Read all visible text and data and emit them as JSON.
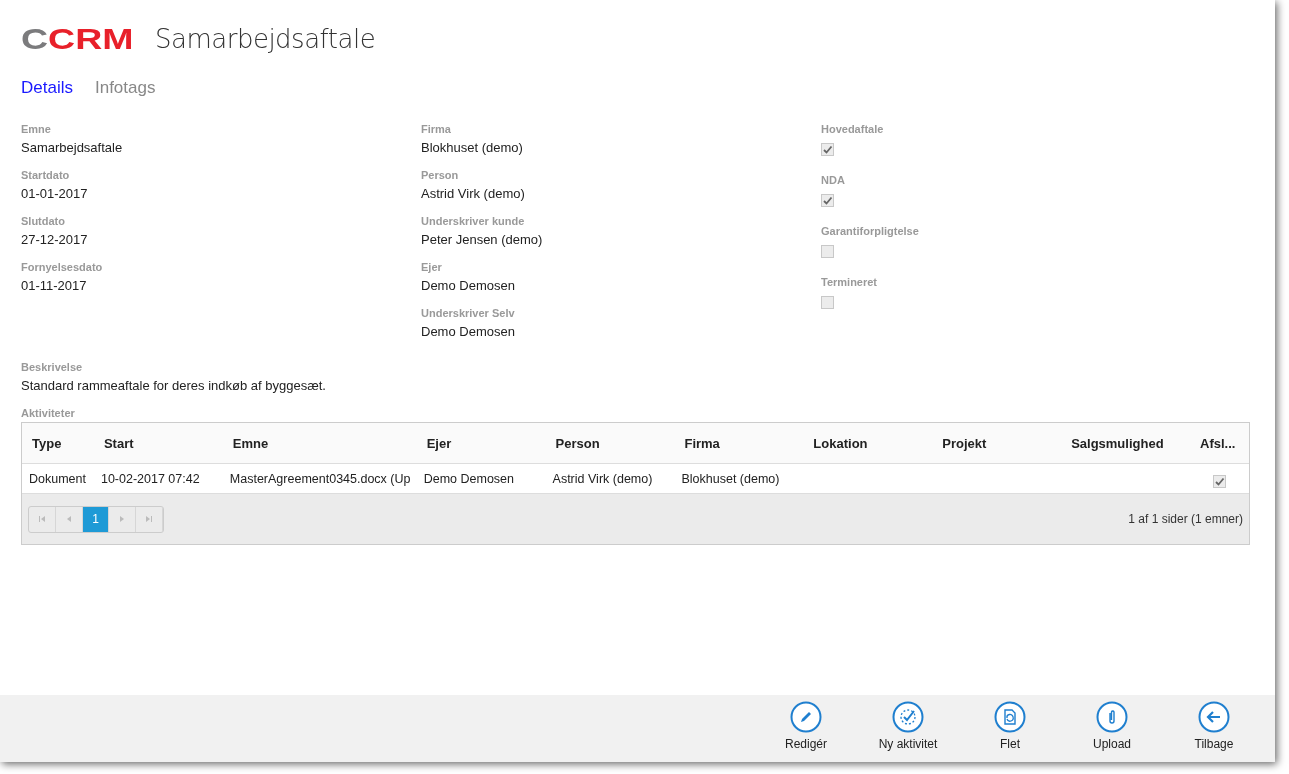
{
  "header": {
    "logo_prefix": "C",
    "logo_main": "CRM",
    "title": "Samarbejdsaftale"
  },
  "tabs": [
    {
      "label": "Details",
      "selected": true
    },
    {
      "label": "Infotags",
      "selected": false
    }
  ],
  "columns": [
    [
      {
        "label": "Emne",
        "value": "Samarbejdsaftale"
      },
      {
        "label": "Startdato",
        "value": "01-01-2017"
      },
      {
        "label": "Slutdato",
        "value": "27-12-2017"
      },
      {
        "label": "Fornyelsesdato",
        "value": "01-11-2017"
      }
    ],
    [
      {
        "label": "Firma",
        "value": "Blokhuset (demo)"
      },
      {
        "label": "Person",
        "value": "Astrid Virk (demo)"
      },
      {
        "label": "Underskriver kunde",
        "value": "Peter Jensen (demo)"
      },
      {
        "label": "Ejer",
        "value": "Demo Demosen"
      },
      {
        "label": "Underskriver Selv",
        "value": "Demo Demosen"
      }
    ]
  ],
  "flags": [
    {
      "label": "Hovedaftale",
      "checked": true
    },
    {
      "label": "NDA",
      "checked": true
    },
    {
      "label": "Garantiforpligtelse",
      "checked": false
    },
    {
      "label": "Termineret",
      "checked": false
    }
  ],
  "description": {
    "label": "Beskrivelse",
    "value": "Standard rammeaftale for deres indkøb af byggesæt."
  },
  "activities": {
    "label": "Aktiviteter",
    "columns": [
      "Type",
      "Start",
      "Emne",
      "Ejer",
      "Person",
      "Firma",
      "Lokation",
      "Projekt",
      "Salgsmulighed",
      "Afsl..."
    ],
    "rows": [
      {
        "cells": [
          "Dokument",
          "10-02-2017 07:42",
          "MasterAgreement0345.docx (Up",
          "Demo Demosen",
          "Astrid Virk (demo)",
          "Blokhuset (demo)",
          "",
          "",
          ""
        ],
        "done": true
      }
    ],
    "pages": [
      {
        "label": "1",
        "selected": true
      }
    ],
    "pager_info": "1 af 1 sider (1 emner)"
  },
  "actions": [
    {
      "kind": "edit",
      "label": "Redigér"
    },
    {
      "kind": "activity",
      "label": "Ny aktivitet"
    },
    {
      "kind": "merge",
      "label": "Flet"
    },
    {
      "kind": "upload",
      "label": "Upload"
    },
    {
      "kind": "back",
      "label": "Tilbage"
    }
  ]
}
